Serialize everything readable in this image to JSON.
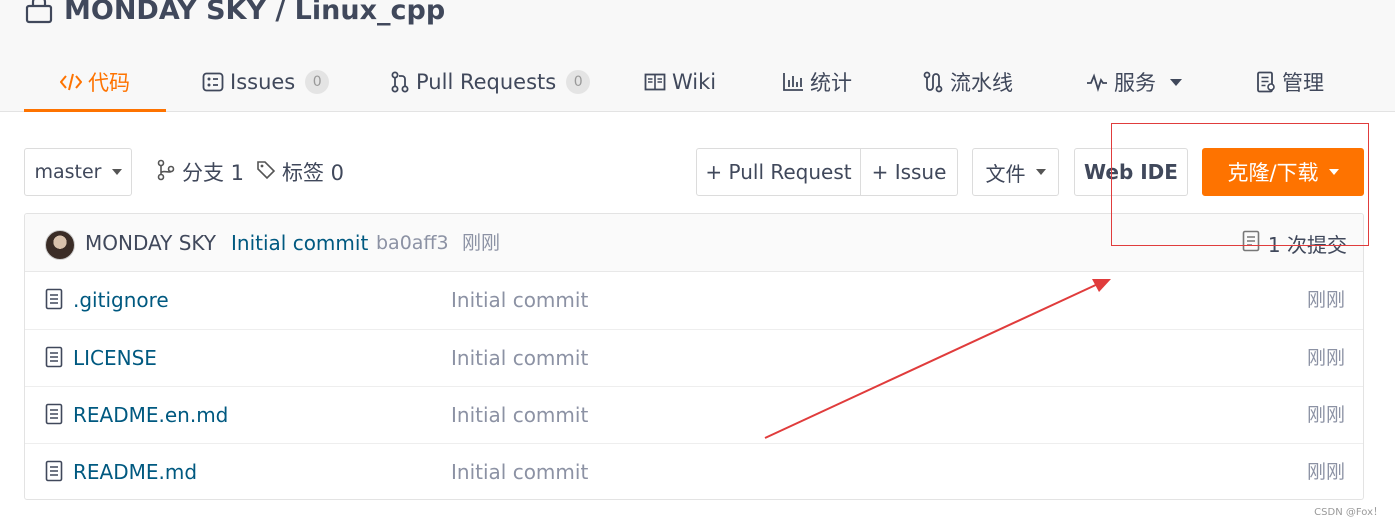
{
  "repo": {
    "title": "MONDAY SKY / Linux_cpp"
  },
  "tabs": [
    {
      "label": "代码",
      "icon": "code-icon"
    },
    {
      "label": "Issues",
      "icon": "issues-icon",
      "count": "0"
    },
    {
      "label": "Pull Requests",
      "icon": "pull-request-icon",
      "count": "0"
    },
    {
      "label": "Wiki",
      "icon": "wiki-icon"
    },
    {
      "label": "统计",
      "icon": "stats-icon"
    },
    {
      "label": "流水线",
      "icon": "pipeline-icon"
    },
    {
      "label": "服务",
      "icon": "service-icon"
    },
    {
      "label": "管理",
      "icon": "manage-icon"
    }
  ],
  "toolbar": {
    "branch": "master",
    "branches_label": "分支 1",
    "tags_label": "标签 0",
    "pull_request_button": "+ Pull Request",
    "issue_button": "+ Issue",
    "file_button": "文件",
    "web_ide_button": "Web IDE",
    "clone_button": "克隆/下载"
  },
  "last_commit": {
    "author": "MONDAY SKY",
    "message": "Initial commit",
    "sha": "ba0aff3",
    "time": "刚刚",
    "count_label": "1 次提交"
  },
  "files": [
    {
      "name": ".gitignore",
      "commit": "Initial commit",
      "time": "刚刚"
    },
    {
      "name": "LICENSE",
      "commit": "Initial commit",
      "time": "刚刚"
    },
    {
      "name": "README.en.md",
      "commit": "Initial commit",
      "time": "刚刚"
    },
    {
      "name": "README.md",
      "commit": "Initial commit",
      "time": "刚刚"
    }
  ],
  "watermark": "CSDN @Fox！",
  "colors": {
    "accent": "#fe7300",
    "link": "#005980",
    "annotation": "#e03c3c"
  }
}
